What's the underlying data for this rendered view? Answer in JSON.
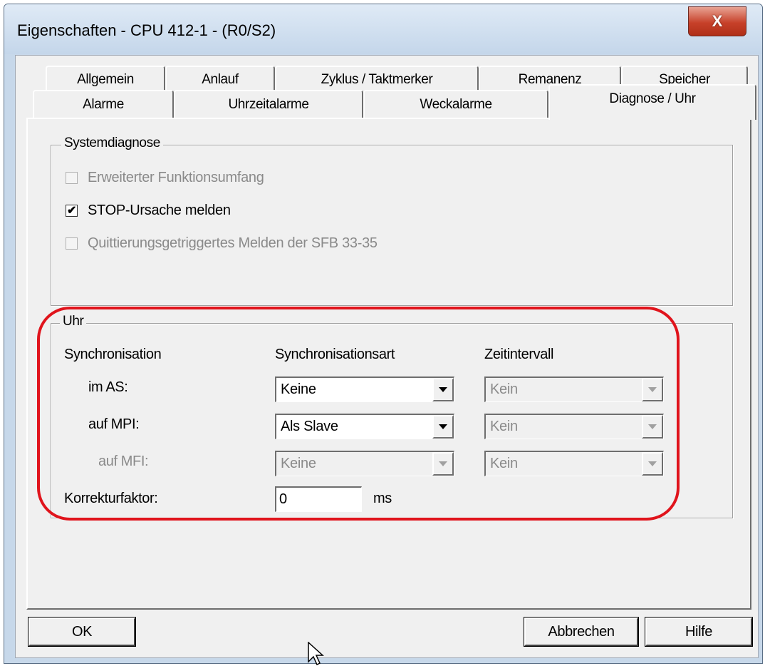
{
  "window": {
    "title": "Eigenschaften - CPU 412-1 - (R0/S2)",
    "close_glyph": "X"
  },
  "tabs": {
    "row_back": [
      "Allgemein",
      "Anlauf",
      "Zyklus / Taktmerker",
      "Remanenz",
      "Speicher"
    ],
    "row_front": [
      "Alarme",
      "Uhrzeitalarme",
      "Weckalarme",
      "Diagnose / Uhr"
    ],
    "active": "Diagnose / Uhr"
  },
  "systemdiagnose": {
    "legend": "Systemdiagnose",
    "options": [
      {
        "label": "Erweiterter Funktionsumfang",
        "checked": false,
        "enabled": false
      },
      {
        "label": "STOP-Ursache melden",
        "checked": true,
        "enabled": true
      },
      {
        "label": "Quittierungsgetriggertes Melden der SFB 33-35",
        "checked": false,
        "enabled": false
      }
    ]
  },
  "uhr": {
    "legend": "Uhr",
    "headers": {
      "sync": "Synchronisation",
      "sync_type": "Synchronisationsart",
      "interval": "Zeitintervall"
    },
    "rows": [
      {
        "label": "im AS:",
        "sync_type": "Keine",
        "interval": "Kein"
      },
      {
        "label": "auf MPI:",
        "sync_type": "Als Slave",
        "interval": "Kein"
      },
      {
        "label": "auf MFI:",
        "sync_type": "Keine",
        "interval": "Kein"
      }
    ],
    "korrektur_label": "Korrekturfaktor:",
    "korrektur_value": "0",
    "korrektur_unit": "ms"
  },
  "buttons": {
    "ok": "OK",
    "cancel": "Abbrechen",
    "help": "Hilfe"
  },
  "colors": {
    "highlight": "#e0141c",
    "close_button": "#c7412a"
  }
}
